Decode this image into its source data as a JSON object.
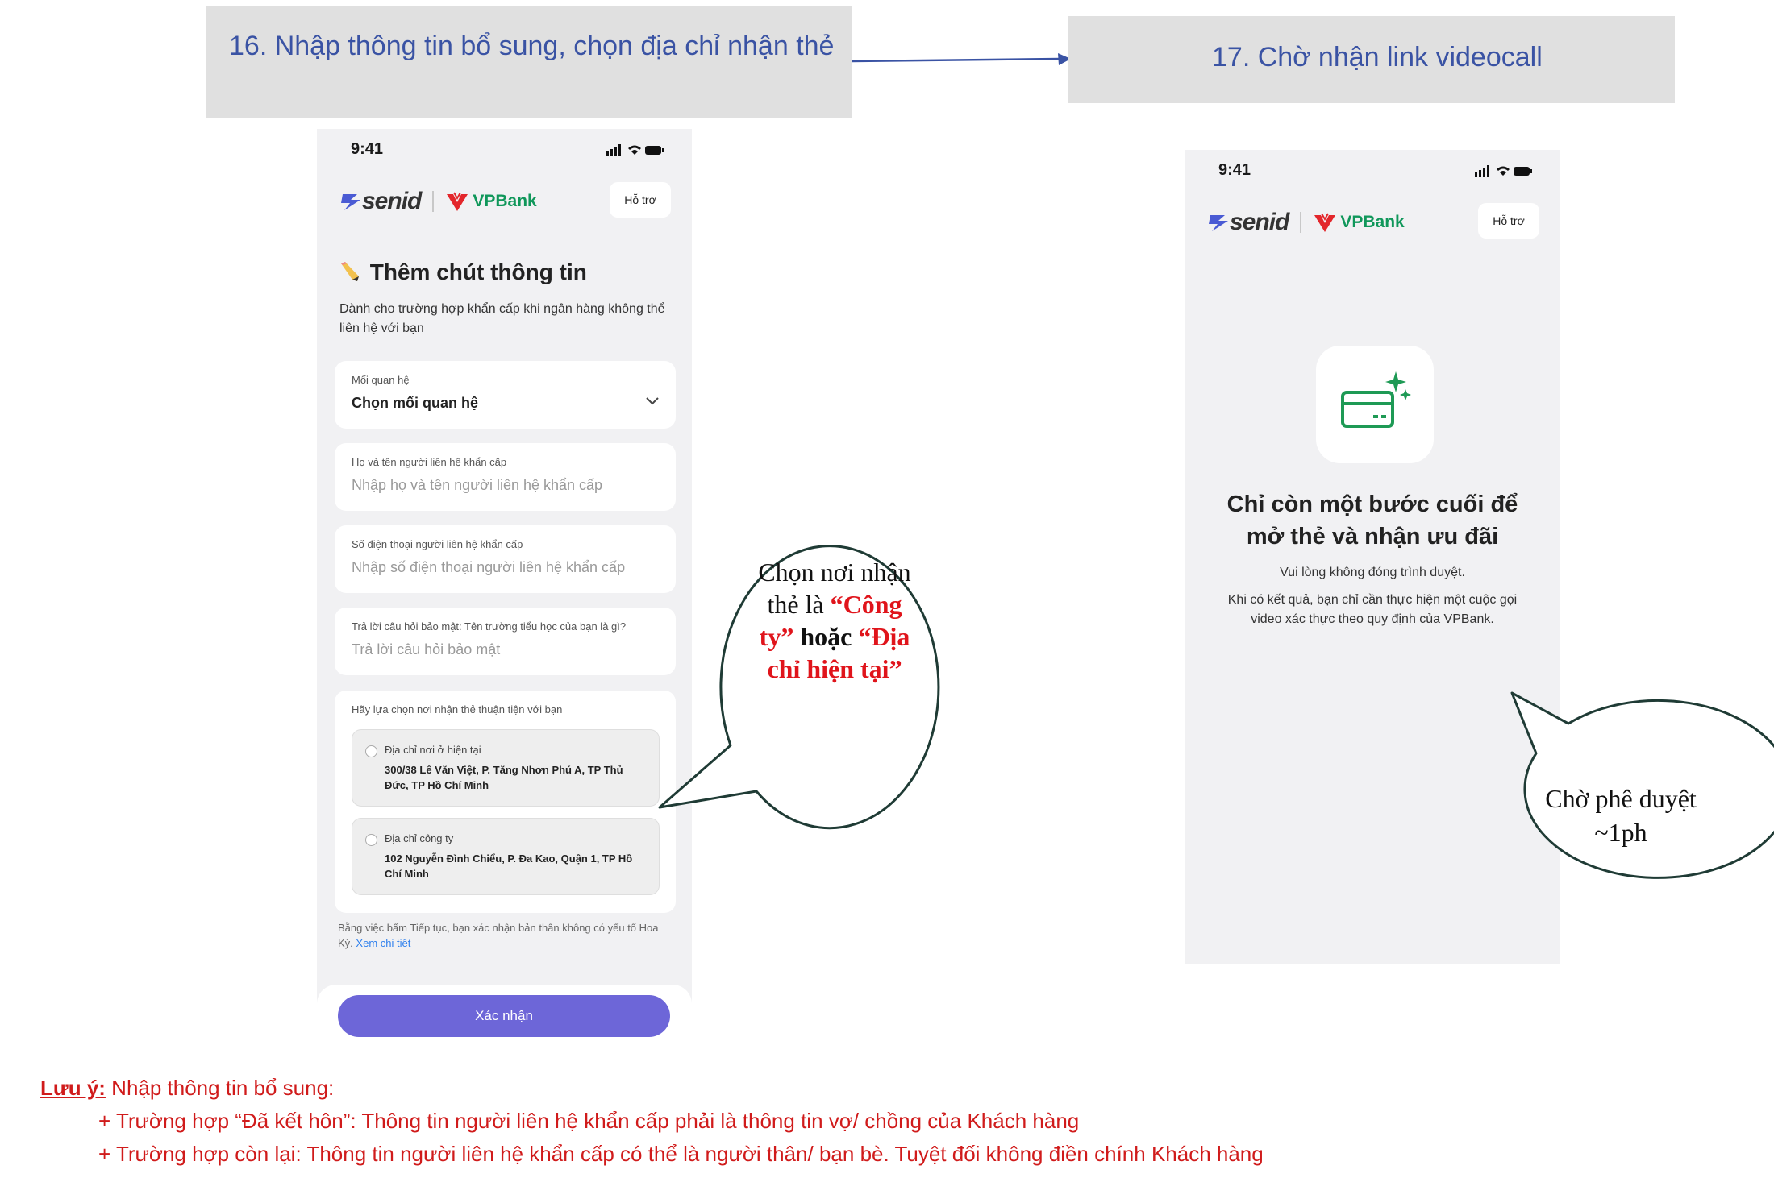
{
  "step16": {
    "label": "16. Nhập thông tin bổ sung, chọn địa chỉ nhận thẻ"
  },
  "step17": {
    "label": "17. Chờ nhận link videocall"
  },
  "phone1": {
    "status_time": "9:41",
    "brand_left": "senid",
    "brand_right": "VPBank",
    "help_label": "Hỗ trợ",
    "title": "Thêm chút thông tin",
    "subtitle": "Dành cho trường hợp khẩn cấp khi ngân hàng không thể liên hệ với bạn",
    "relationship": {
      "label": "Mối quan hệ",
      "value": "Chọn mối quan hệ"
    },
    "contact_name": {
      "label": "Họ và tên người liên hệ khẩn cấp",
      "placeholder": "Nhập họ và tên người liên hệ khẩn cấp"
    },
    "contact_phone": {
      "label": "Số điện thoại người liên hệ khẩn cấp",
      "placeholder": "Nhập số điện thoại người liên hệ khẩn cấp"
    },
    "security_answer": {
      "label": "Trả lời câu hỏi bảo mật: Tên trường tiểu học của bạn là gì?",
      "placeholder": "Trả lời câu hỏi bảo mật"
    },
    "delivery": {
      "prompt": "Hãy lựa chọn nơi nhận thẻ thuận tiện với bạn",
      "options": [
        {
          "title": "Địa chỉ nơi ở hiện tại",
          "address": "300/38 Lê Văn Việt, P. Tăng Nhơn Phú A, TP Thủ Đức, TP Hồ Chí Minh"
        },
        {
          "title": "Địa chỉ công ty",
          "address": "102 Nguyễn Đình Chiểu, P. Đa Kao, Quận 1, TP Hồ Chí Minh"
        }
      ]
    },
    "disclaimer": "Bằng việc bấm Tiếp tục, bạn xác nhận bản thân không có yếu tố Hoa Kỳ.",
    "disclaimer_link": "Xem chi tiết",
    "confirm_label": "Xác nhận"
  },
  "phone2": {
    "status_time": "9:41",
    "brand_left": "senid",
    "brand_right": "VPBank",
    "help_label": "Hỗ trợ",
    "icon": "credit-card-sparkle-icon",
    "title": "Chỉ còn một bước cuối để mở thẻ và nhận ưu đãi",
    "line1": "Vui lòng không đóng trình duyệt.",
    "line2": "Khi có kết quả, bạn chỉ cần thực hiện một cuộc gọi video xác thực theo quy định của VPBank."
  },
  "callout1": {
    "part1": "Chọn nơi nhận thẻ là ",
    "part2": "“Công ty”",
    "part3": " hoặc ",
    "part4": "“Địa chỉ hiện tại”"
  },
  "callout2": {
    "text": "Chờ phê duyệt ~1ph"
  },
  "note": {
    "key": "Lưu ý:",
    "intro": " Nhập thông tin bổ sung:",
    "line1": "+ Trường hợp “Đã kết hôn”: Thông tin người liên hệ khẩn cấp phải là thông tin vợ/ chồng của Khách hàng",
    "line2": "+ Trường hợp còn lại: Thông tin người liên hệ khẩn cấp có thể là người thân/ bạn bè. Tuyệt đối không điền chính Khách hàng"
  },
  "colors": {
    "step_text": "#3a53a4",
    "step_bg": "#e0e0e0",
    "vpbank_green": "#10975a",
    "vpbank_red": "#e3262b",
    "button_purple": "#6d66d8",
    "note_red": "#d01b1b",
    "bubble_border": "#1f3b35"
  }
}
